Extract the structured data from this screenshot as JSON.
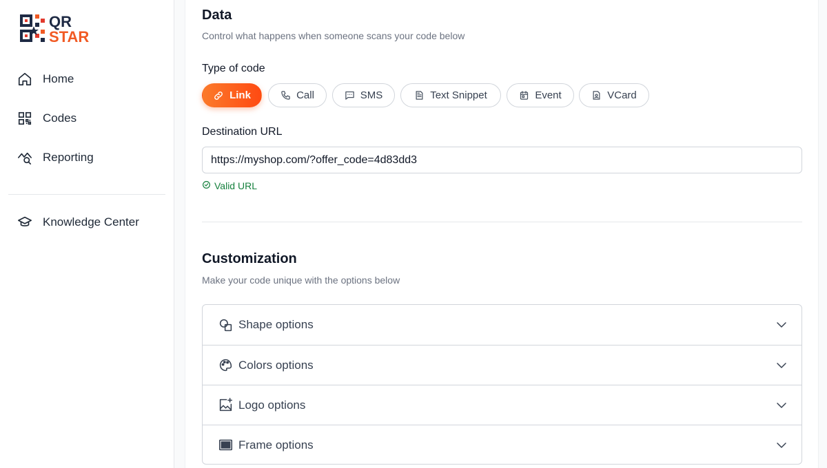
{
  "brand": {
    "line1": "QR",
    "line2": "STAR",
    "colors": {
      "dark": "#1e2a44",
      "orange": "#f15a24",
      "red": "#e23a2d"
    }
  },
  "sidebar": {
    "items": [
      {
        "label": "Home",
        "icon": "home-icon"
      },
      {
        "label": "Codes",
        "icon": "qr-code-icon"
      },
      {
        "label": "Reporting",
        "icon": "chart-search-icon"
      }
    ],
    "secondary": [
      {
        "label": "Knowledge Center",
        "icon": "graduation-cap-icon"
      }
    ]
  },
  "data_section": {
    "title": "Data",
    "description": "Control what happens when someone scans your code below",
    "type_label": "Type of code",
    "types": [
      {
        "label": "Link",
        "icon": "link-icon",
        "active": true
      },
      {
        "label": "Call",
        "icon": "phone-icon",
        "active": false
      },
      {
        "label": "SMS",
        "icon": "message-icon",
        "active": false
      },
      {
        "label": "Text Snippet",
        "icon": "document-icon",
        "active": false
      },
      {
        "label": "Event",
        "icon": "calendar-icon",
        "active": false
      },
      {
        "label": "VCard",
        "icon": "contact-card-icon",
        "active": false
      }
    ],
    "url_label": "Destination URL",
    "url_value": "https://myshop.com/?offer_code=4d83dd3",
    "validation": "Valid URL"
  },
  "customization": {
    "title": "Customization",
    "description": "Make your code unique with the options below",
    "options": [
      {
        "label": "Shape options",
        "icon": "shapes-icon"
      },
      {
        "label": "Colors options",
        "icon": "palette-icon"
      },
      {
        "label": "Logo options",
        "icon": "image-plus-icon"
      },
      {
        "label": "Frame options",
        "icon": "frame-icon"
      }
    ]
  },
  "theme": {
    "accent_start": "#fb7a2b",
    "accent_end": "#ff4a12",
    "success": "#15803d",
    "border": "#d1d5db"
  }
}
